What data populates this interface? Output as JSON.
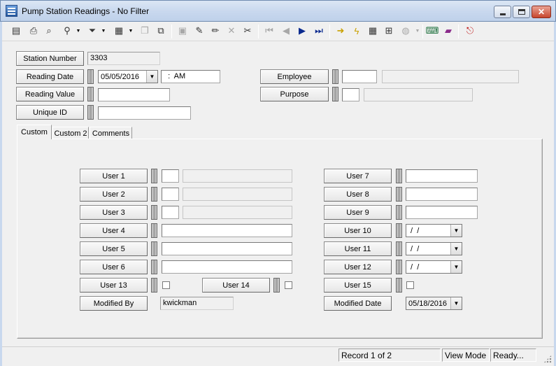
{
  "window": {
    "title": "Pump Station Readings - No Filter",
    "app_icon": "table-grid-icon",
    "controls": {
      "minimize": "minimize-icon",
      "maximize": "maximize-icon",
      "close": "✕"
    }
  },
  "toolbar": {
    "items": [
      {
        "name": "new-record-icon",
        "glyph": "▤",
        "enabled": false
      },
      {
        "name": "print-icon",
        "glyph": "⎙",
        "enabled": true
      },
      {
        "name": "print-preview-icon",
        "glyph": "⌕",
        "enabled": true
      },
      {
        "name": "binoculars-find-icon",
        "glyph": "⚲",
        "enabled": true,
        "dropdown": true
      },
      {
        "name": "filter-funnel-icon",
        "glyph": "⏷",
        "enabled": true,
        "dropdown": true
      },
      {
        "name": "report-icon",
        "glyph": "▦",
        "enabled": true,
        "dropdown": true
      },
      {
        "name": "copy-form-icon",
        "glyph": "❐",
        "enabled": false
      },
      {
        "name": "export-icon",
        "glyph": "⧉",
        "enabled": true
      },
      {
        "name": "save-icon",
        "glyph": "▣",
        "enabled": false
      },
      {
        "name": "add-record-icon",
        "glyph": "✎",
        "enabled": true
      },
      {
        "name": "edit-pencil-icon",
        "glyph": "✏",
        "enabled": true
      },
      {
        "name": "delete-icon",
        "glyph": "✕",
        "enabled": false
      },
      {
        "name": "cut-scissors-icon",
        "glyph": "✂",
        "enabled": true
      },
      {
        "name": "first-record-icon",
        "glyph": "⏮",
        "enabled": false
      },
      {
        "name": "previous-record-icon",
        "glyph": "◀",
        "enabled": false
      },
      {
        "name": "next-record-icon",
        "glyph": "▶",
        "enabled": true
      },
      {
        "name": "last-record-icon",
        "glyph": "⏭",
        "enabled": true
      },
      {
        "name": "goto-arrow-icon",
        "glyph": "➜",
        "enabled": true
      },
      {
        "name": "lightning-icon",
        "glyph": "ϟ",
        "enabled": true
      },
      {
        "name": "grid-view-icon",
        "glyph": "▦",
        "enabled": true
      },
      {
        "name": "hierarchy-icon",
        "glyph": "⊞",
        "enabled": true
      },
      {
        "name": "chat-bubble-icon",
        "glyph": "◍",
        "enabled": false,
        "dropdown": true
      },
      {
        "name": "keyboard-icon",
        "glyph": "⌨",
        "enabled": true
      },
      {
        "name": "book-icon",
        "glyph": "▰",
        "enabled": true
      },
      {
        "name": "exit-door-icon",
        "glyph": "⎋",
        "enabled": true
      }
    ]
  },
  "header": {
    "station_number": {
      "label": "Station Number",
      "value": "3303"
    },
    "reading_date": {
      "label": "Reading Date",
      "date": "05/05/2016",
      "time": "  :  AM"
    },
    "reading_value": {
      "label": "Reading Value",
      "value": ""
    },
    "unique_id": {
      "label": "Unique ID",
      "value": ""
    },
    "employee": {
      "label": "Employee",
      "code": "",
      "name": ""
    },
    "purpose": {
      "label": "Purpose",
      "code": "",
      "description": ""
    }
  },
  "tabs": [
    {
      "label": "Custom",
      "active": true
    },
    {
      "label": "Custom 2",
      "active": false
    },
    {
      "label": "Comments",
      "active": false
    }
  ],
  "custom": {
    "user1": {
      "label": "User 1",
      "code": "",
      "desc": ""
    },
    "user2": {
      "label": "User 2",
      "code": "",
      "desc": ""
    },
    "user3": {
      "label": "User 3",
      "code": "",
      "desc": ""
    },
    "user4": {
      "label": "User 4",
      "value": ""
    },
    "user5": {
      "label": "User 5",
      "value": ""
    },
    "user6": {
      "label": "User 6",
      "value": ""
    },
    "user7": {
      "label": "User 7",
      "value": ""
    },
    "user8": {
      "label": "User 8",
      "value": ""
    },
    "user9": {
      "label": "User 9",
      "value": ""
    },
    "user10": {
      "label": "User 10",
      "value": " /  /"
    },
    "user11": {
      "label": "User 11",
      "value": " /  /"
    },
    "user12": {
      "label": "User 12",
      "value": " /  /"
    },
    "user13": {
      "label": "User 13",
      "checked": false
    },
    "user14": {
      "label": "User 14",
      "checked": false
    },
    "user15": {
      "label": "User 15",
      "checked": false
    },
    "modified_by": {
      "label": "Modified By",
      "value": "kwickman"
    },
    "modified_date": {
      "label": "Modified Date",
      "value": "05/18/2016"
    }
  },
  "status": {
    "blank": "",
    "record": "Record 1 of 2",
    "mode": "View Mode",
    "state": "Ready..."
  }
}
